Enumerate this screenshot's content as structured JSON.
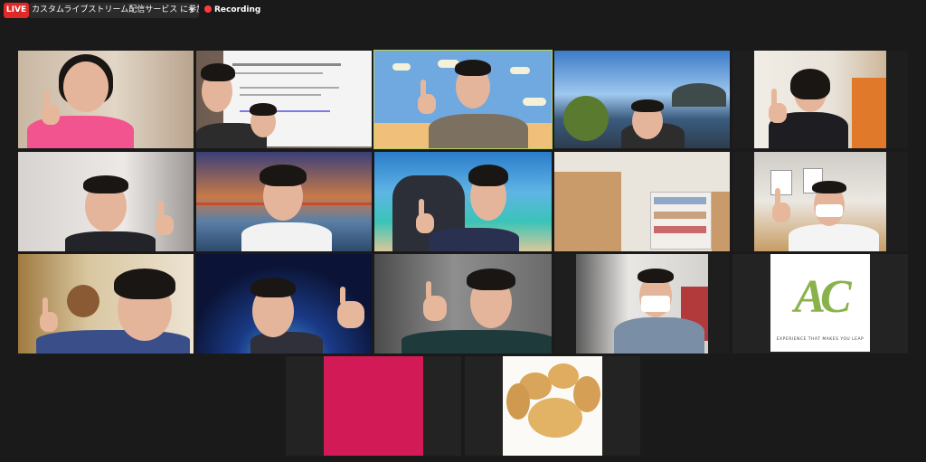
{
  "topbar": {
    "live_label": "LIVE",
    "session_title": "カスタムライブストリーム配信サービス に参加中",
    "recording_label": "Recording"
  },
  "logo": {
    "letters": "AC",
    "tagline": "EXPERIENCE THAT MAKES YOU LEAP",
    "color": "#8ab24c"
  },
  "colors": {
    "background": "#1a1a1a",
    "tile": "#232323",
    "active_speaker_border": "#b8d35a",
    "live_badge": "#e02828",
    "pink_tile": "#d21a56"
  }
}
